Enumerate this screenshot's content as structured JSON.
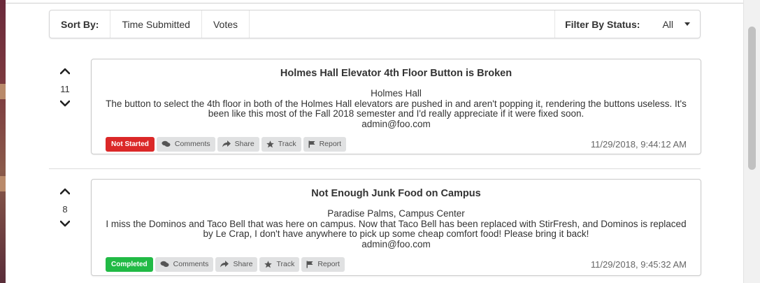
{
  "sort_bar": {
    "sort_label": "Sort By:",
    "options": [
      "Time Submitted",
      "Votes"
    ],
    "filter_label": "Filter By Status:",
    "filter_value": "All"
  },
  "posts": [
    {
      "votes": "11",
      "title": "Holmes Hall Elevator 4th Floor Button is Broken",
      "location": "Holmes Hall",
      "description": "The button to select the 4th floor in both of the Holmes Hall elevators are pushed in and aren't popping it, rendering the buttons useless. It's been like this most of the Fall 2018 semester and I'd really appreciate if it were fixed soon.",
      "author": "admin@foo.com",
      "status": "Not Started",
      "status_color": "#db2828",
      "timestamp": "11/29/2018, 9:44:12 AM"
    },
    {
      "votes": "8",
      "title": "Not Enough Junk Food on Campus",
      "location": "Paradise Palms, Campus Center",
      "description": "I miss the Dominos and Taco Bell that was here on campus. Now that Taco Bell has been replaced with StirFresh, and Dominos is replaced by Le Crap, I don't have anywhere to pick up some cheap comfort food! Please bring it back!",
      "author": "admin@foo.com",
      "status": "Completed",
      "status_color": "#21ba45",
      "timestamp": "11/29/2018, 9:45:32 AM"
    }
  ],
  "actions": {
    "comments": "Comments",
    "share": "Share",
    "track": "Track",
    "report": "Report"
  },
  "icons": {
    "upvote": "chevron-up-icon",
    "downvote": "chevron-down-icon",
    "comments": "comments-icon",
    "share": "share-icon",
    "track": "star-icon",
    "report": "flag-icon",
    "filter": "caret-down-icon"
  }
}
